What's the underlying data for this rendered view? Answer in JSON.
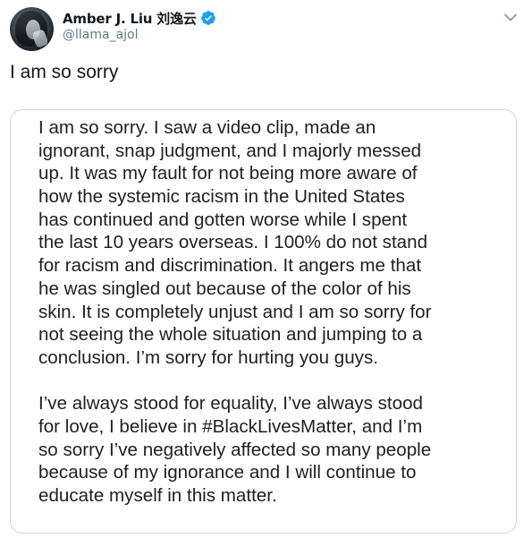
{
  "author": {
    "display_name": "Amber J. Liu 刘逸云",
    "handle": "@llama_ajol",
    "verified": true,
    "avatar_icon": "profile-photo"
  },
  "menu": {
    "icon": "chevron-down-icon"
  },
  "tweet": {
    "text": "I am so sorry"
  },
  "media": {
    "paragraph1": [
      "I am so sorry. I saw a video clip, made an",
      "ignorant, snap judgment, and I majorly messed",
      "up. It was my fault for not being more aware of",
      "how the systemic racism in the United States",
      "has continued and gotten worse while I spent",
      "the last 10 years overseas. I 100% do not stand",
      "for racism and discrimination. It angers me that",
      "he was singled out because of the color of his",
      "skin. It is completely unjust and I am so sorry for",
      "not seeing the whole situation and jumping to a",
      "conclusion. I’m sorry for hurting you guys."
    ],
    "paragraph2": [
      "I’ve always stood for equality, I’ve always stood",
      "for love, I believe in #BlackLivesMatter, and I’m",
      "so sorry I’ve negatively affected so many people",
      "because of my ignorance and I will continue to",
      "educate myself in this matter."
    ]
  },
  "colors": {
    "verified_blue": "#1da1f2",
    "secondary_text": "#657786",
    "border": "#ccd6dd"
  }
}
